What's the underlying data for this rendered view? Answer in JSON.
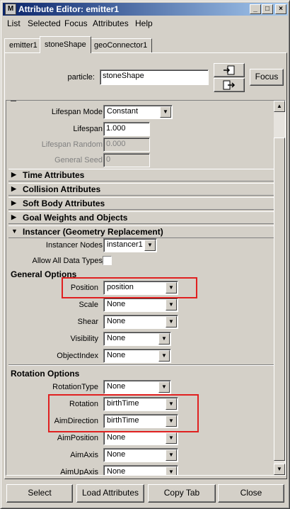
{
  "window": {
    "title": "Attribute Editor: emitter1",
    "app_icon": "M"
  },
  "menu": [
    "List",
    "Selected",
    "Focus",
    "Attributes",
    "Help"
  ],
  "tabs": [
    "emitter1",
    "stoneShape",
    "geoConnector1"
  ],
  "node": {
    "label": "particle:",
    "value": "stoneShape",
    "focus_label": "Focus"
  },
  "lifespan": {
    "mode_label": "Lifespan Mode",
    "mode_value": "Constant",
    "lifespan_label": "Lifespan",
    "lifespan_value": "1.000",
    "random_label": "Lifespan Random",
    "random_value": "0.000",
    "seed_label": "General Seed",
    "seed_value": "0"
  },
  "sections": {
    "time": "Time Attributes",
    "collision": "Collision Attributes",
    "softbody": "Soft Body Attributes",
    "goal": "Goal Weights and Objects",
    "instancer": "Instancer (Geometry Replacement)"
  },
  "instancer": {
    "nodes_label": "Instancer Nodes",
    "nodes_value": "instancer1",
    "allow_label": "Allow All Data Types"
  },
  "general_options": {
    "heading": "General Options",
    "rows": [
      {
        "label": "Position",
        "value": "position"
      },
      {
        "label": "Scale",
        "value": "None"
      },
      {
        "label": "Shear",
        "value": "None"
      },
      {
        "label": "Visibility",
        "value": "None"
      },
      {
        "label": "ObjectIndex",
        "value": "None"
      }
    ]
  },
  "rotation_options": {
    "heading": "Rotation Options",
    "rows": [
      {
        "label": "RotationType",
        "value": "None"
      },
      {
        "label": "Rotation",
        "value": "birthTime"
      },
      {
        "label": "AimDirection",
        "value": "birthTime"
      },
      {
        "label": "AimPosition",
        "value": "None"
      },
      {
        "label": "AimAxis",
        "value": "None"
      },
      {
        "label": "AimUpAxis",
        "value": "None"
      }
    ]
  },
  "footer": [
    "Select",
    "Load Attributes",
    "Copy Tab",
    "Close"
  ],
  "colors": {
    "highlight": "#e02020",
    "title_bar": "#0a246a"
  }
}
